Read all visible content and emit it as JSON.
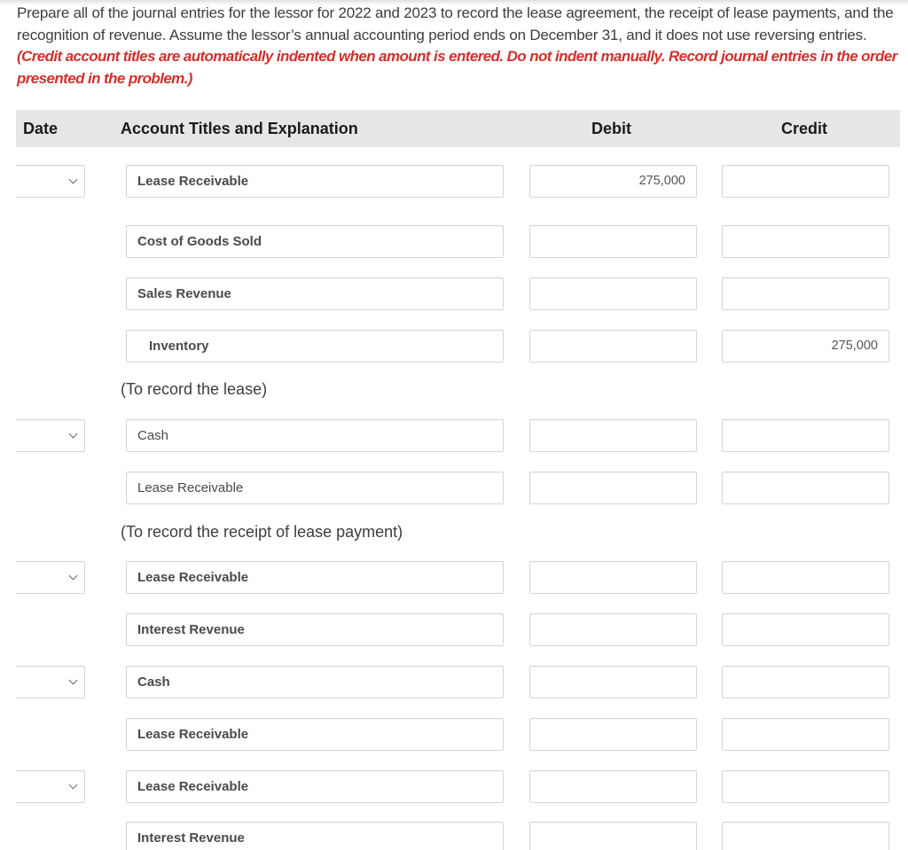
{
  "instructions": {
    "text": "Prepare all of the journal entries for the lessor for 2022 and 2023 to record the lease agreement, the receipt of lease payments, and the recognition of revenue. Assume the lessor’s annual accounting period ends on December 31, and it does not use reversing entries.",
    "note": "(Credit account titles are automatically indented when amount is entered. Do not indent manually. Record journal entries in the order presented in the problem.)",
    "note_color": "#d0312d"
  },
  "table": {
    "headers": {
      "date": "Date",
      "account": "Account Titles and Explanation",
      "debit": "Debit",
      "credit": "Credit"
    },
    "rows": [
      {
        "date": "",
        "has_date": true,
        "account": "Lease Receivable",
        "debit": "275,000",
        "credit": ""
      },
      {
        "date": "",
        "has_date": false,
        "account": "Cost of Goods Sold",
        "debit": "",
        "credit": ""
      },
      {
        "date": "",
        "has_date": false,
        "account": "Sales Revenue",
        "debit": "",
        "credit": ""
      },
      {
        "date": "",
        "has_date": false,
        "account": "Inventory",
        "debit": "",
        "credit": "275,000"
      },
      {
        "date": "",
        "has_date": true,
        "account": "Cash",
        "debit": "",
        "credit": ""
      },
      {
        "date": "",
        "has_date": false,
        "account": "Lease Receivable",
        "debit": "",
        "credit": ""
      },
      {
        "date": "",
        "has_date": true,
        "account": "Lease Receivable",
        "debit": "",
        "credit": ""
      },
      {
        "date": "",
        "has_date": false,
        "account": "Interest Revenue",
        "debit": "",
        "credit": ""
      },
      {
        "date": "",
        "has_date": true,
        "account": "Cash",
        "debit": "",
        "credit": ""
      },
      {
        "date": "",
        "has_date": false,
        "account": "Lease Receivable",
        "debit": "",
        "credit": ""
      },
      {
        "date": "",
        "has_date": true,
        "account": "Lease Receivable",
        "debit": "",
        "credit": ""
      },
      {
        "date": "",
        "has_date": false,
        "account": "Interest Revenue",
        "debit": "",
        "credit": ""
      }
    ],
    "explanations": [
      "(To record the lease)",
      "(To record the receipt of lease payment)"
    ]
  }
}
